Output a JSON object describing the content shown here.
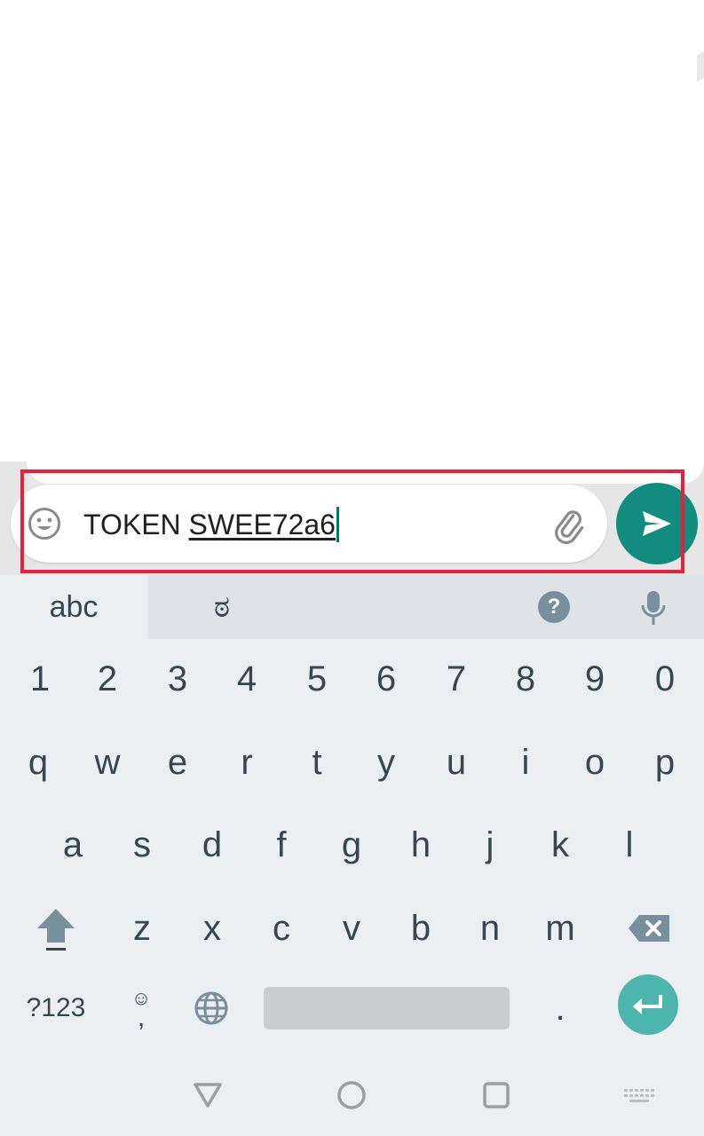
{
  "compose": {
    "text_prefix": "TOKEN ",
    "text_suggestion": "SWEE72a6"
  },
  "keyboard": {
    "tabs": [
      "abc",
      "ಠ"
    ],
    "help_label": "?",
    "number_row": [
      "1",
      "2",
      "3",
      "4",
      "5",
      "6",
      "7",
      "8",
      "9",
      "0"
    ],
    "row1": [
      "q",
      "w",
      "e",
      "r",
      "t",
      "y",
      "u",
      "i",
      "o",
      "p"
    ],
    "row2": [
      "a",
      "s",
      "d",
      "f",
      "g",
      "h",
      "j",
      "k",
      "l"
    ],
    "row3": [
      "z",
      "x",
      "c",
      "v",
      "b",
      "n",
      "m"
    ],
    "symbols_key": "?123",
    "emoji_comma_top": "☺",
    "emoji_comma_bottom": ",",
    "period_key": "."
  },
  "colors": {
    "accent": "#128c7e",
    "enter": "#4db6ac",
    "highlight": "#e8203a"
  },
  "icons": {
    "emoji": "smiley-icon",
    "attach": "paperclip-icon",
    "send": "send-icon",
    "mic": "microphone-icon",
    "shift": "shift-icon",
    "backspace": "backspace-icon",
    "globe": "globe-icon",
    "enter": "enter-icon",
    "nav_back": "back-triangle-icon",
    "nav_home": "home-circle-icon",
    "nav_recents": "recents-square-icon",
    "nav_keyboard": "keyboard-icon"
  }
}
